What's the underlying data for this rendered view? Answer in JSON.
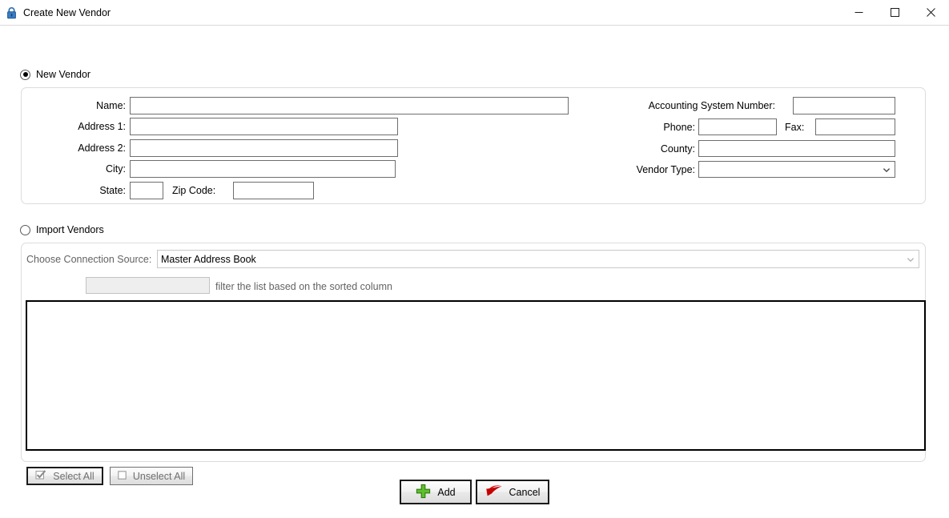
{
  "window": {
    "title": "Create New Vendor",
    "icon": "lock-icon",
    "controls": {
      "minimize": "minimize-icon",
      "maximize": "maximize-icon",
      "close": "close-icon"
    }
  },
  "mode": {
    "new_vendor": {
      "label": "New Vendor",
      "selected": true
    },
    "import_vendors": {
      "label": "Import Vendors",
      "selected": false
    }
  },
  "new_vendor_form": {
    "fields": [
      {
        "label": "Name:",
        "value": ""
      },
      {
        "label": "Address 1:",
        "value": ""
      },
      {
        "label": "Address 2:",
        "value": ""
      },
      {
        "label": "City:",
        "value": ""
      },
      {
        "label": "State:",
        "value": ""
      },
      {
        "label": "Zip Code:",
        "value": ""
      }
    ],
    "right_fields": [
      {
        "label": "Accounting System Number:",
        "value": ""
      },
      {
        "label": "Phone:",
        "value": ""
      },
      {
        "label": "Fax:",
        "value": ""
      },
      {
        "label": "County:",
        "value": ""
      }
    ],
    "vendor_type": {
      "label": "Vendor Type:",
      "value": "",
      "chevron": "chevron-down-icon"
    }
  },
  "import_form": {
    "connection_source": {
      "label": "Choose Connection Source:",
      "value": "Master Address Book",
      "chevron": "chevron-down-icon"
    },
    "filter": {
      "value": "",
      "placeholder": "",
      "hint": "filter the list based on the sorted column"
    },
    "list_items": []
  },
  "actions": {
    "select_all": {
      "label": "Select All",
      "icon": "check-mark-icon"
    },
    "unselect_all": {
      "label": "Unselect All",
      "icon": "empty-checkbox-icon"
    },
    "add": {
      "label": "Add",
      "icon": "green-plus-icon"
    },
    "cancel": {
      "label": "Cancel",
      "icon": "red-undo-arrow-icon"
    }
  },
  "colors": {
    "accent_lock": "#1f5fa0",
    "add_icon_green": "#4caf23",
    "cancel_icon_red": "#e00000",
    "group_border": "#dcdcdc",
    "input_border": "#6e6e6e",
    "disabled_text": "#636363"
  }
}
